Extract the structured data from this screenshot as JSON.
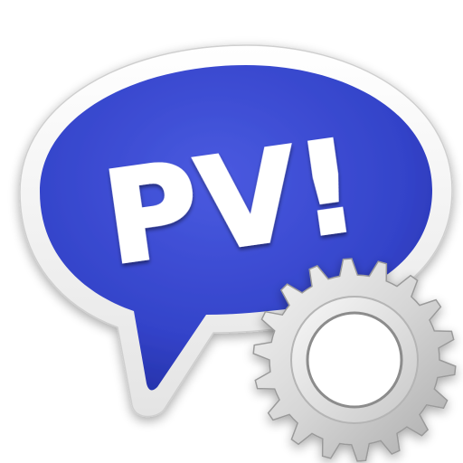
{
  "icon": {
    "bubble_text": "PV!",
    "bubble_color": "#3343c9",
    "bubble_border_color": "#f2f2f2",
    "text_color": "#ffffff",
    "gear_color": "#d8d8d8",
    "overlay_icon": "gear-icon",
    "main_icon": "speech-bubble-icon"
  }
}
